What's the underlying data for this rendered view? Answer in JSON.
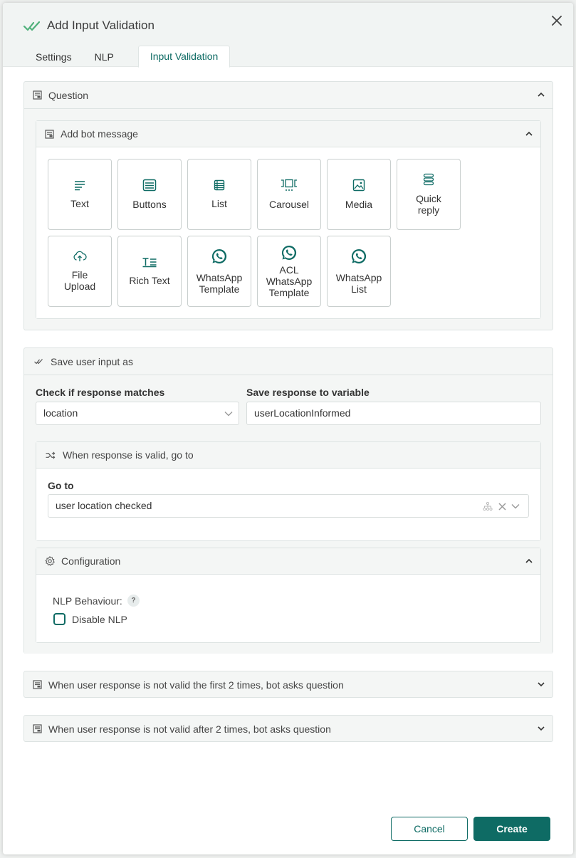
{
  "dialog": {
    "title": "Add Input Validation",
    "tabs": [
      {
        "label": "Settings"
      },
      {
        "label": "NLP"
      },
      {
        "label": "Input Validation"
      }
    ]
  },
  "question": {
    "title": "Question",
    "bot_message": {
      "title": "Add bot message",
      "tiles": [
        {
          "label": "Text",
          "icon": "text-icon"
        },
        {
          "label": "Buttons",
          "icon": "buttons-icon"
        },
        {
          "label": "List",
          "icon": "list-icon"
        },
        {
          "label": "Carousel",
          "icon": "carousel-icon"
        },
        {
          "label": "Media",
          "icon": "media-icon"
        },
        {
          "label": "Quick\nreply",
          "icon": "quick-reply-icon"
        },
        {
          "label": "File\nUpload",
          "icon": "upload-icon"
        },
        {
          "label": "Rich Text",
          "icon": "rich-text-icon"
        },
        {
          "label": "WhatsApp\nTemplate",
          "icon": "whatsapp-icon"
        },
        {
          "label": "ACL\nWhatsApp\nTemplate",
          "icon": "whatsapp-icon"
        },
        {
          "label": "WhatsApp\nList",
          "icon": "whatsapp-icon"
        }
      ]
    }
  },
  "save_input": {
    "title": "Save user input as",
    "check_label": "Check if response matches",
    "check_value": "location",
    "save_label": "Save response to variable",
    "save_value": "userLocationInformed",
    "valid_goto": {
      "title": "When response is valid, go to",
      "goto_label": "Go to",
      "goto_value": "user location checked"
    },
    "configuration": {
      "title": "Configuration",
      "nlp_behaviour_label": "NLP Behaviour:",
      "help": "?",
      "disable_nlp_label": "Disable NLP",
      "disable_nlp_checked": false
    }
  },
  "invalid_first": {
    "title": "When user response is not valid the first 2 times, bot asks question"
  },
  "invalid_after": {
    "title": "When user response is not valid after 2 times, bot asks question"
  },
  "footer": {
    "cancel_label": "Cancel",
    "create_label": "Create"
  },
  "colors": {
    "accent": "#0e6b64",
    "check_green": "#4fb07a"
  }
}
